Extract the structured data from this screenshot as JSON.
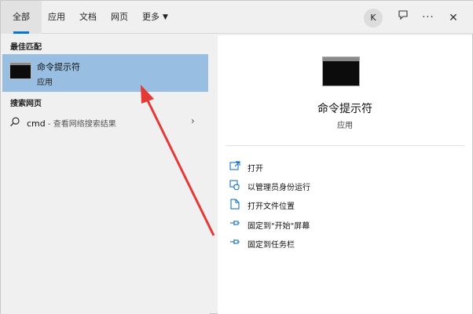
{
  "tabs": {
    "all": "全部",
    "apps": "应用",
    "documents": "文档",
    "web": "网页",
    "more": "更多"
  },
  "header": {
    "avatar_letter": "K",
    "feedback_icon": "feedback-icon",
    "more_icon": "ellipsis-icon",
    "close_icon": "close-icon"
  },
  "left": {
    "best_match_heading": "最佳匹配",
    "best_match": {
      "title": "命令提示符",
      "subtitle": "应用",
      "icon": "cmd-app-icon"
    },
    "web_heading": "搜索网页",
    "web_result": {
      "query": "cmd",
      "hint": " - 查看网络搜索结果",
      "icon": "search-icon"
    }
  },
  "right": {
    "title": "命令提示符",
    "subtitle": "应用",
    "actions": [
      {
        "label": "打开",
        "icon": "open-icon"
      },
      {
        "label": "以管理员身份运行",
        "icon": "shield-icon"
      },
      {
        "label": "打开文件位置",
        "icon": "file-location-icon"
      },
      {
        "label": "固定到\"开始\"屏幕",
        "icon": "pin-icon"
      },
      {
        "label": "固定到任务栏",
        "icon": "pin-icon"
      }
    ]
  },
  "colors": {
    "selection": "#98bfe2",
    "accent": "#0078d4",
    "annotation": "#e53935"
  }
}
